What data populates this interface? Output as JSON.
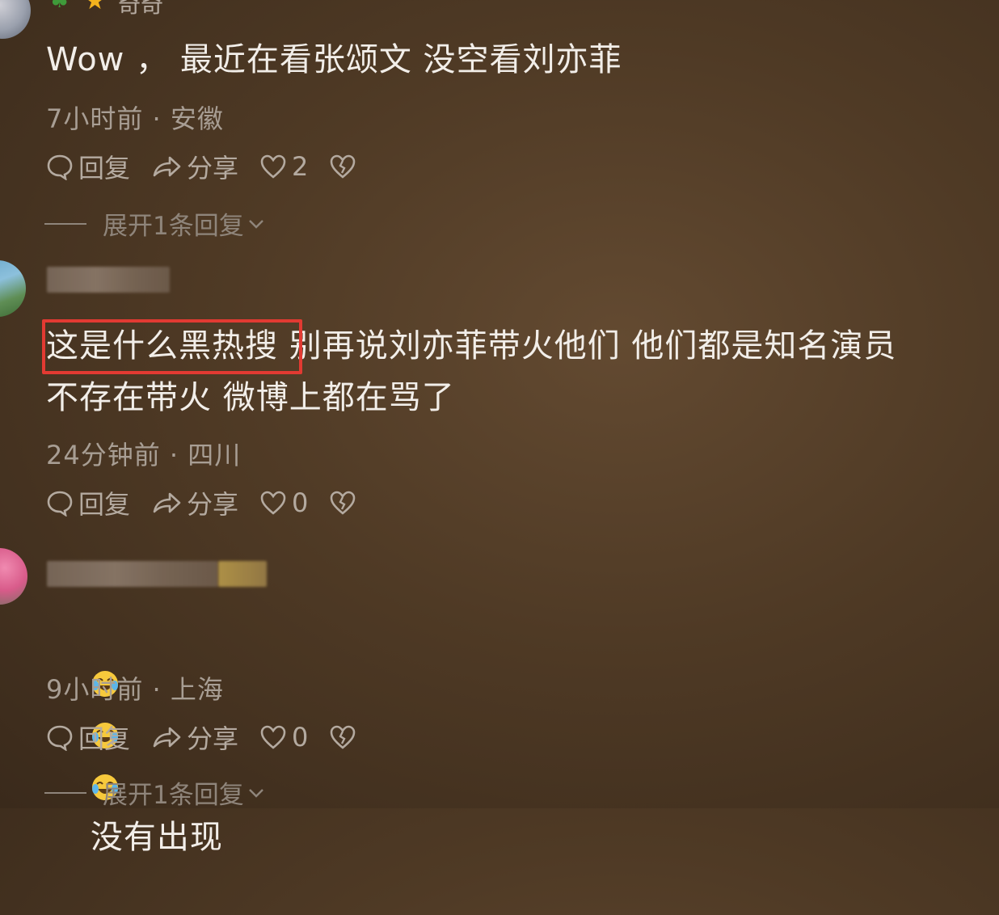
{
  "comments": [
    {
      "user": "奇奇",
      "text": "Wow ， 最近在看张颂文 没空看刘亦菲",
      "time": "7小时前",
      "location": "安徽",
      "reply_label": "回复",
      "share_label": "分享",
      "likes": "2",
      "expand_label": "展开1条回复"
    },
    {
      "highlight": "这是什么黑热搜",
      "text_rest": " 别再说刘亦菲带火他们 他们都是知名演员\n不存在带火 微博上都在骂了",
      "time": "24分钟前",
      "location": "四川",
      "reply_label": "回复",
      "share_label": "分享",
      "likes": "0"
    },
    {
      "text": "没有出现",
      "time": "9小时前",
      "location": "上海",
      "reply_label": "回复",
      "share_label": "分享",
      "likes": "0",
      "expand_label": "展开1条回复"
    }
  ],
  "separator": "·",
  "colors": {
    "background": "#4f3a25",
    "highlight_border": "#e23a32",
    "text_primary": "#f2eee9",
    "text_meta": "#a89e94"
  },
  "icons": [
    "comment-bubble-icon",
    "share-arrow-icon",
    "heart-icon",
    "broken-heart-icon",
    "crying-laugh-emoji",
    "clover-icon",
    "star-icon"
  ]
}
